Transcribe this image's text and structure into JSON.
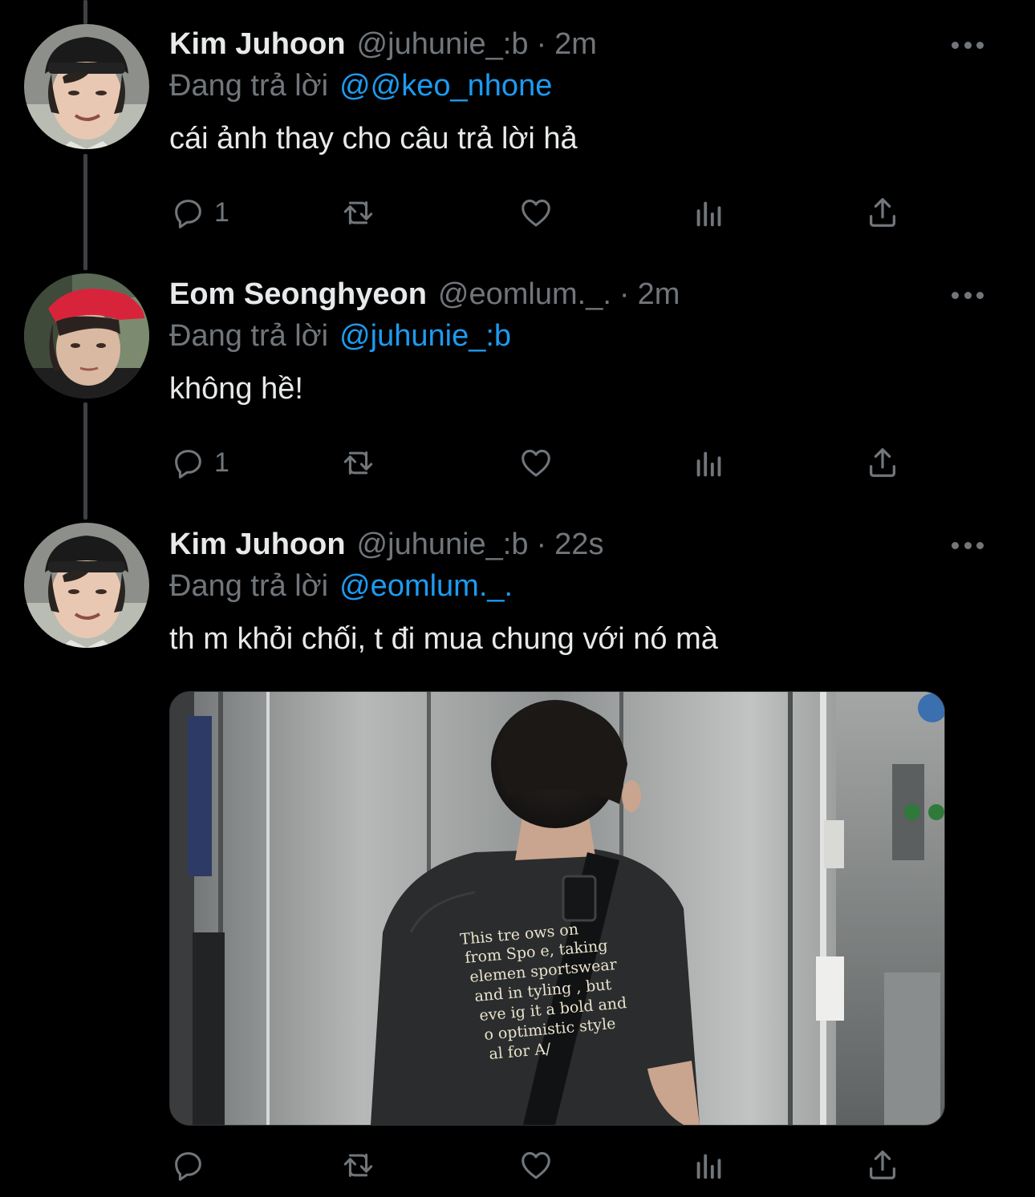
{
  "colors": {
    "background": "#000000",
    "text_primary": "#e7e9ea",
    "text_secondary": "#71767b",
    "link": "#1d9bf0",
    "thread_line": "#3e4144"
  },
  "tweets": [
    {
      "display_name": "Kim Juhoon",
      "handle": "@juhunie_:b",
      "separator": "·",
      "time": "2m",
      "reply_prefix": "Đang trả lời",
      "reply_to": "@@keo_nhone",
      "text": "cái ảnh thay cho câu trả lời hả",
      "reply_count": "1",
      "avatar": "avatar-photo-black-cap",
      "more_icon": "more-dots-icon"
    },
    {
      "display_name": "Eom Seonghyeon",
      "handle": "@eomlum._.",
      "separator": "·",
      "time": "2m",
      "reply_prefix": "Đang trả lời",
      "reply_to": "@juhunie_:b",
      "text": "không hề!",
      "reply_count": "1",
      "avatar": "avatar-photo-red-cap",
      "more_icon": "more-dots-icon"
    },
    {
      "display_name": "Kim Juhoon",
      "handle": "@juhunie_:b",
      "separator": "·",
      "time": "22s",
      "reply_prefix": "Đang trả lời",
      "reply_to": "@eomlum._.",
      "text": "th m khỏi chối, t đi mua chung với nó mà",
      "reply_count": "",
      "avatar": "avatar-photo-black-cap",
      "more_icon": "more-dots-icon",
      "media": {
        "description_icon": "elevator-photo",
        "shirt_text": [
          "This tre     ows on",
          "from Spo      e, taking",
          "elemen     sportswear",
          "and     in tyling , but",
          "eve   ig it a bold and",
          "o   optimistic  style",
          "al for A/"
        ]
      }
    }
  ],
  "action_icons": [
    "reply-icon",
    "retweet-icon",
    "like-icon",
    "analytics-icon",
    "share-icon"
  ]
}
